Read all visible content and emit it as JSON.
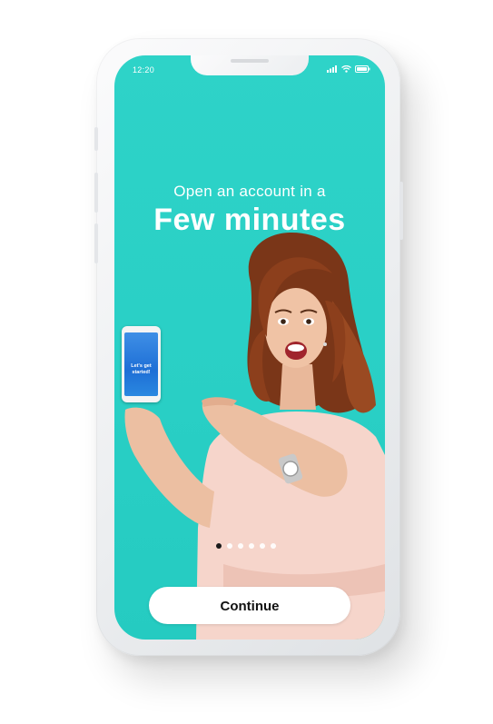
{
  "status_bar": {
    "time": "12:20"
  },
  "onboarding": {
    "headline_small": "Open an account in a",
    "headline_big": "Few minutes",
    "pagination": {
      "total": 6,
      "active": 1
    },
    "continue_label": "Continue"
  },
  "mini_phone": {
    "text": "Let's get started!"
  },
  "colors": {
    "background": "#29cfc5",
    "button": "#ffffff",
    "active_dot": "#1a1a1a"
  }
}
